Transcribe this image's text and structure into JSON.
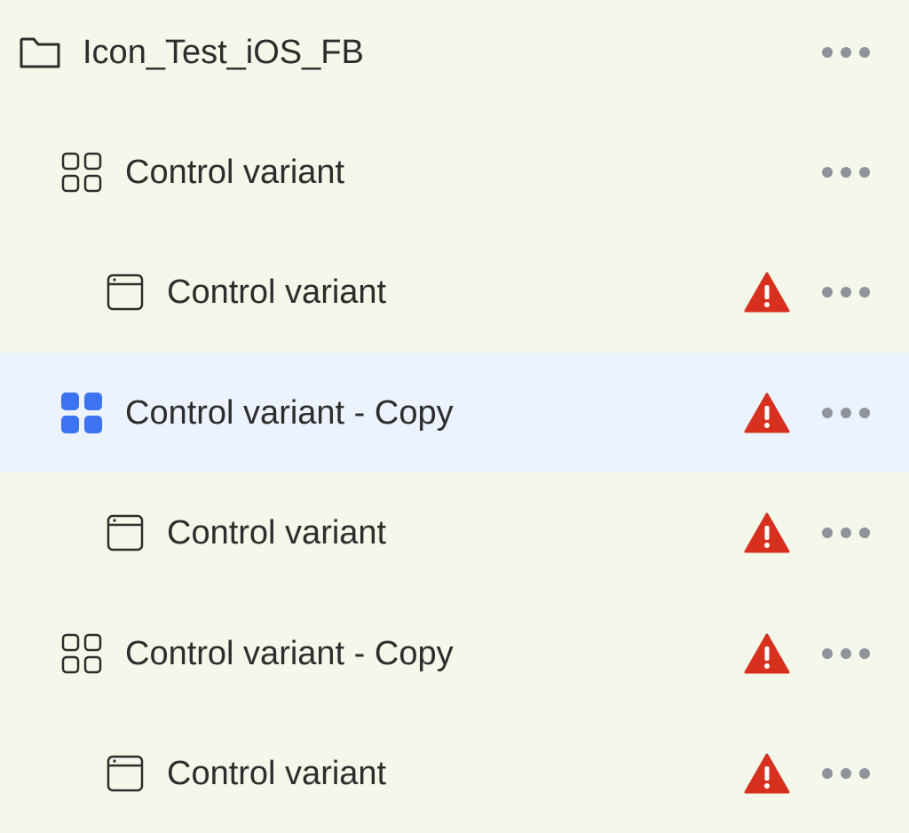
{
  "colors": {
    "background": "#f3f8eb",
    "selected_background": "#ecf3fe",
    "accent": "#3b73f0",
    "warning": "#d7301f",
    "icon_stroke": "#2d2d2d",
    "more_dots": "#8f939b"
  },
  "rows": [
    {
      "label": "Icon_Test_iOS_FB",
      "icon": "folder-icon",
      "level": 0,
      "warning": false,
      "selected": false
    },
    {
      "label": "Control variant",
      "icon": "grid-icon",
      "level": 1,
      "warning": false,
      "selected": false
    },
    {
      "label": "Control variant",
      "icon": "screen-icon",
      "level": 2,
      "warning": true,
      "selected": false
    },
    {
      "label": "Control variant - Copy",
      "icon": "grid-icon",
      "level": 1,
      "warning": true,
      "selected": true
    },
    {
      "label": "Control variant",
      "icon": "screen-icon",
      "level": 2,
      "warning": true,
      "selected": false
    },
    {
      "label": "Control variant - Copy",
      "icon": "grid-icon",
      "level": 1,
      "warning": true,
      "selected": false
    },
    {
      "label": "Control variant",
      "icon": "screen-icon",
      "level": 2,
      "warning": true,
      "selected": false
    }
  ]
}
